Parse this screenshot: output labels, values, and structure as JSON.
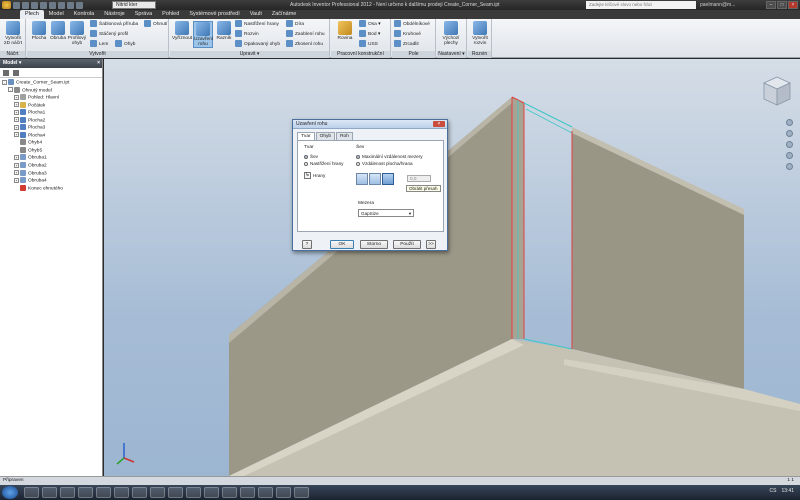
{
  "titlebar": {
    "style_combo": "Nitrid kter",
    "window_title": "Autodesk Inventor Professional 2012 - Není určeno k dalšímu prodeji    Create_Corner_Seam.ipt",
    "search_placeholder": "Zadejte klíčové slovo nebo frázi",
    "user": "paelmann@m..."
  },
  "ribbon": {
    "tabs": [
      "Plech",
      "Model",
      "Kontrola",
      "Nástroje",
      "Správa",
      "Pohled",
      "Systémové prostředí",
      "Vault",
      "Začínáme"
    ],
    "panels": {
      "nacrt": {
        "label": "Náčrt",
        "create_sketch": "Vytvořit 2D náčrt"
      },
      "vytvorit": {
        "label": "Vytvořit",
        "plocha": "Plocha",
        "obruba": "Obruba",
        "profilovy_ohyb": "Profilový ohyb",
        "sablonova_prisuba": "Šablonová příruba",
        "staceny_profil": "Stáčený profil",
        "lem": "Lem",
        "ohyb": "Ohyb",
        "ohnuti": "Ohnutí"
      },
      "upravit": {
        "label": "Upravit ▾",
        "vyrtnout": "Vyříznout",
        "uzavreni_rohu": "Uzavření rohu",
        "razník": "Razník",
        "nastrizeni_hrany": "Nastřižení hrany",
        "rozvin": "Rozvin",
        "opakovany_ohyb": "Opakovaný ohyb",
        "zaobleni_rohu": "Zaoblení rohu",
        "zkoseni_rohu": "Zkosení rohu",
        "dira": "Díra"
      },
      "prac": {
        "label": "Pracovní konstrukční prvky",
        "rovina": "Rovina",
        "osa": "Osa ▾",
        "bod": "Bod ▾",
        "usc": "USS"
      },
      "pole": {
        "label": "Pole",
        "obdelnikove": "Obdélníkové",
        "kruhove": "Kruhové",
        "zrcadlit": "Zrcadlit"
      },
      "nastaveni": {
        "label": "Nastavení ▾",
        "vychozi": "Výchozí plechy"
      },
      "rozvin": {
        "label": "Rozvin",
        "vytvorit": "Vytvořit rozvin"
      }
    }
  },
  "browser": {
    "title": "Model ▾",
    "items": [
      {
        "label": "Create_Corner_Seam.ipt",
        "level": 0,
        "exp": "-",
        "color": "#6b8fbf"
      },
      {
        "label": "Ohnutý model",
        "level": 1,
        "exp": "-",
        "color": "#8a8a8a"
      },
      {
        "label": "Pohled: Hlavní",
        "level": 2,
        "exp": "+",
        "color": "#a0a0a0"
      },
      {
        "label": "Počátek",
        "level": 2,
        "exp": "+",
        "color": "#d8b24a"
      },
      {
        "label": "Plocha1",
        "level": 2,
        "exp": "+",
        "color": "#4f7fc0"
      },
      {
        "label": "Plocha2",
        "level": 2,
        "exp": "+",
        "color": "#4f7fc0"
      },
      {
        "label": "Plocha3",
        "level": 2,
        "exp": "+",
        "color": "#4f7fc0"
      },
      {
        "label": "Plocha4",
        "level": 2,
        "exp": "+",
        "color": "#4f7fc0"
      },
      {
        "label": "Ohyb4",
        "level": 2,
        "exp": "",
        "color": "#888888"
      },
      {
        "label": "Ohyb5",
        "level": 2,
        "exp": "",
        "color": "#888888"
      },
      {
        "label": "Obruba1",
        "level": 2,
        "exp": "+",
        "color": "#7a9bc9"
      },
      {
        "label": "Obruba2",
        "level": 2,
        "exp": "+",
        "color": "#7a9bc9"
      },
      {
        "label": "Obruba3",
        "level": 2,
        "exp": "+",
        "color": "#7a9bc9"
      },
      {
        "label": "Obruba4",
        "level": 2,
        "exp": "+",
        "color": "#7a9bc9"
      },
      {
        "label": "Konec ohnutého",
        "level": 2,
        "exp": "",
        "color": "#d23b2f"
      }
    ]
  },
  "dialog": {
    "title": "Uzavření rohu",
    "tabs": [
      "Tvar",
      "Ohyb",
      "Roh"
    ],
    "tvar_group": "Tvar",
    "radio_sev": "Šev",
    "radio_nastrizeni": "Nastřižení hrany",
    "hrany_label": "Hrany",
    "sev_group": "Šev",
    "radio_max": "Maximální vzdálenost mezery",
    "radio_vzdalenost": "Vzdálenost plocha/hrana",
    "spin_value": "0,0",
    "tooltip": "Obrátit přesah",
    "mezera_label": "Mezera",
    "mezera_value": "GapSize",
    "ok": "OK",
    "storno": "Storno",
    "pouzit": "Použít",
    "more": ">>",
    "help": "?"
  },
  "status": {
    "text": "Připraven",
    "counts": "1     1"
  },
  "taskbar": {
    "lang": "CS",
    "clock": "13:41"
  },
  "colors": {
    "accent": "#3399ff",
    "viewport_sky": "#a7bdd6",
    "part": "#aaa597",
    "edge_highlight": "#e04040",
    "edge_cyan": "#3bc7c7"
  }
}
